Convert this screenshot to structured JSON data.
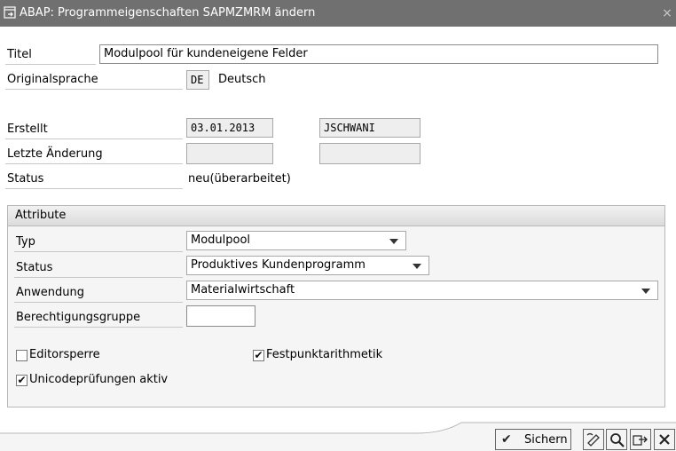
{
  "window": {
    "title": "ABAP: Programmeigenschaften SAPMZMRM ändern",
    "close_glyph": "×"
  },
  "fields": {
    "titel": {
      "label": "Titel",
      "value": "Modulpool für kundeneigene Felder"
    },
    "originalsprache": {
      "label": "Originalsprache",
      "code": "DE",
      "text": "Deutsch"
    },
    "erstellt": {
      "label": "Erstellt",
      "date": "03.01.2013",
      "user": "JSCHWANI"
    },
    "letzte_aenderung": {
      "label": "Letzte Änderung",
      "date": "",
      "user": ""
    },
    "status": {
      "label": "Status",
      "value": "neu(überarbeitet)"
    }
  },
  "attribute": {
    "header": "Attribute",
    "typ": {
      "label": "Typ",
      "value": "Modulpool"
    },
    "status": {
      "label": "Status",
      "value": "Produktives Kundenprogramm"
    },
    "anwendung": {
      "label": "Anwendung",
      "value": "Materialwirtschaft"
    },
    "berechtigungsgruppe": {
      "label": "Berechtigungsgruppe",
      "value": ""
    },
    "editorsperre": {
      "label": "Editorsperre",
      "checked": false
    },
    "festpunktarithmetik": {
      "label": "Festpunktarithmetik",
      "checked": true
    },
    "unicode": {
      "label": "Unicodeprüfungen aktiv",
      "checked": true
    }
  },
  "buttons": {
    "save_label": "Sichern",
    "check_glyph": "✔"
  },
  "icons": [
    "window-icon",
    "close-icon",
    "save-checkmark-icon",
    "help-icon",
    "search-icon",
    "transfer-icon",
    "cancel-icon"
  ]
}
